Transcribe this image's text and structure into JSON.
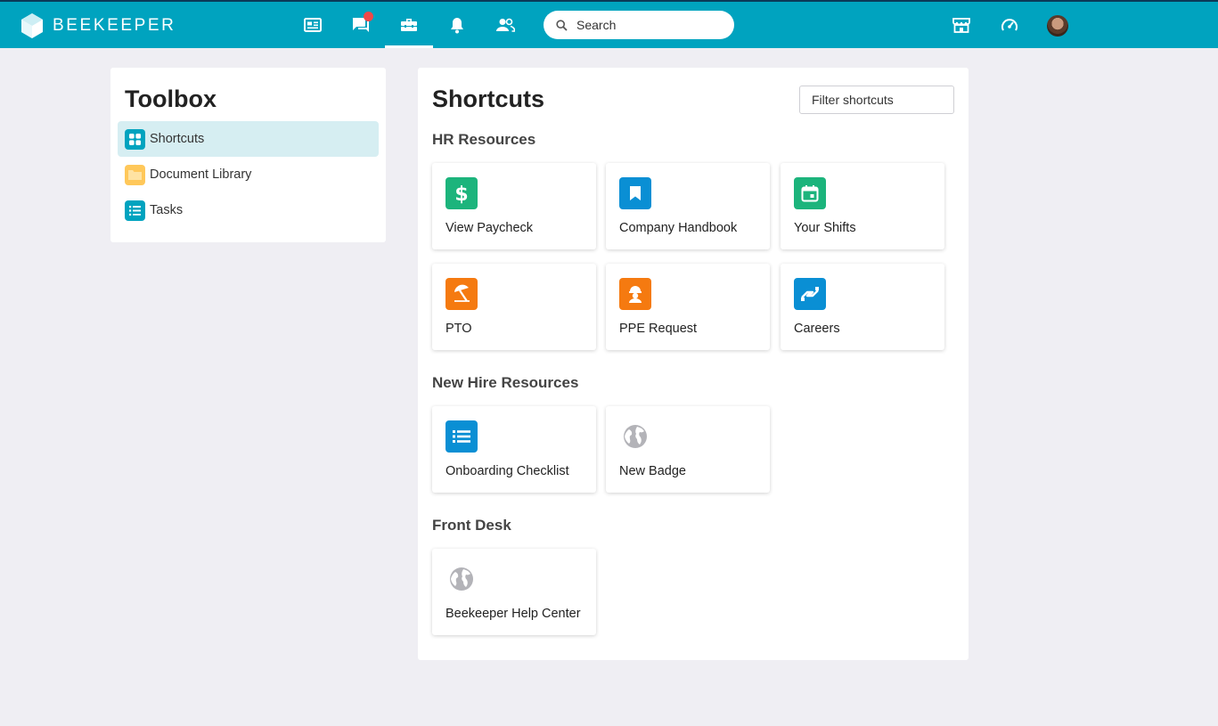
{
  "app": {
    "name": "BEEKEEPER"
  },
  "topbar": {
    "nav": [
      {
        "name": "news-feed-icon"
      },
      {
        "name": "chat-icon",
        "has_notification": true
      },
      {
        "name": "toolbox-icon",
        "active": true
      },
      {
        "name": "notifications-bell-icon"
      },
      {
        "name": "people-icon"
      }
    ],
    "search": {
      "placeholder": "Search"
    },
    "right": [
      {
        "name": "store-icon"
      },
      {
        "name": "dashboard-gauge-icon"
      },
      {
        "name": "user-avatar"
      }
    ]
  },
  "toolbox": {
    "title": "Toolbox",
    "items": [
      {
        "label": "Shortcuts",
        "icon": "grid-icon",
        "active": true
      },
      {
        "label": "Document Library",
        "icon": "folder-icon"
      },
      {
        "label": "Tasks",
        "icon": "list-icon"
      }
    ]
  },
  "shortcuts": {
    "title": "Shortcuts",
    "filter_placeholder": "Filter shortcuts",
    "sections": [
      {
        "title": "HR Resources",
        "cards": [
          {
            "label": "View Paycheck",
            "icon": "dollar-icon",
            "color": "#1cb47c"
          },
          {
            "label": "Company Handbook",
            "icon": "bookmark-icon",
            "color": "#0a8fd4"
          },
          {
            "label": "Your Shifts",
            "icon": "calendar-icon",
            "color": "#1cb47c"
          },
          {
            "label": "PTO",
            "icon": "beach-umbrella-icon",
            "color": "#f57a10"
          },
          {
            "label": "PPE Request",
            "icon": "hard-hat-worker-icon",
            "color": "#f57a10"
          },
          {
            "label": "Careers",
            "icon": "handshake-icon",
            "color": "#0a8fd4"
          }
        ]
      },
      {
        "title": "New Hire Resources",
        "cards": [
          {
            "label": "Onboarding Checklist",
            "icon": "checklist-icon",
            "color": "#0a8fd4"
          },
          {
            "label": "New Badge",
            "icon": "globe-icon",
            "color": "#b3b3b8"
          }
        ]
      },
      {
        "title": "Front Desk",
        "cards": [
          {
            "label": "Beekeeper Help Center",
            "icon": "globe-icon",
            "color": "#b3b3b8"
          }
        ]
      }
    ]
  },
  "colors": {
    "topbar": "#00a3bf",
    "active_item_bg": "#d6eef2",
    "page_bg": "#efeef3"
  }
}
